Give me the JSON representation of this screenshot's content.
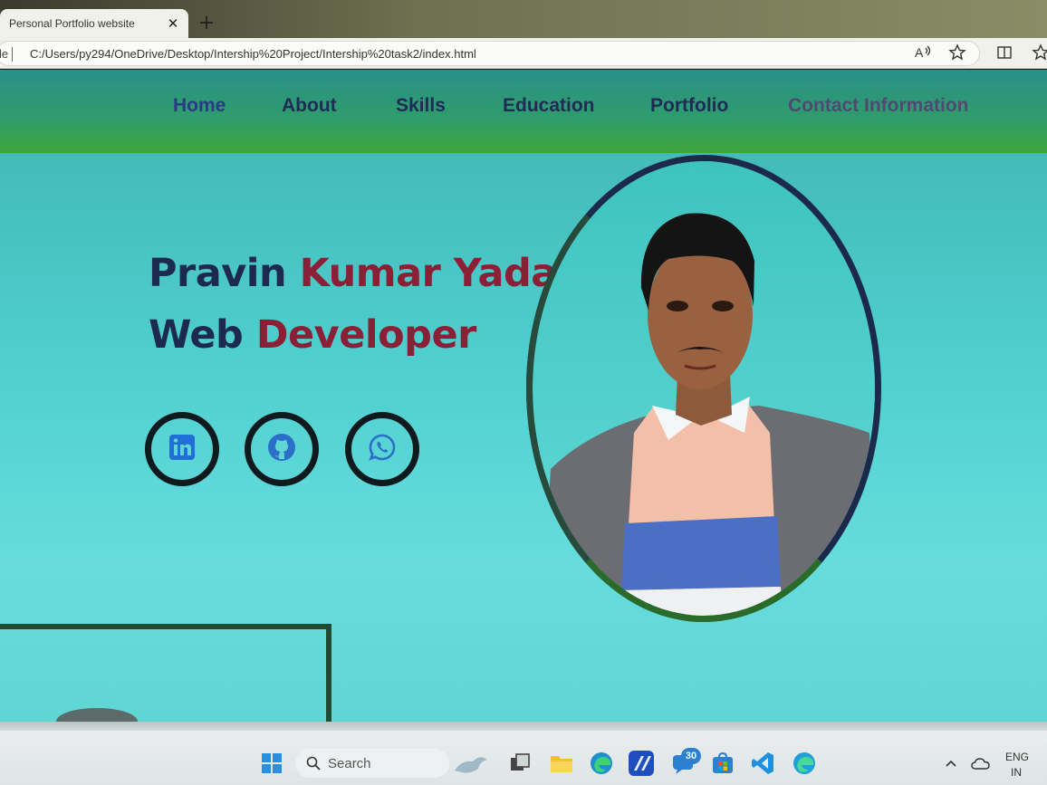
{
  "browser": {
    "tab_title": "Personal Portfolio website",
    "tab_close_glyph": "✕",
    "new_tab_glyph": "+",
    "site_info_label": "le",
    "url": "C:/Users/py294/OneDrive/Desktop/Intership%20Project/Intership%20task2/index.html",
    "toolbar_icons": [
      "read-aloud-icon",
      "favorite-star-icon",
      "split-screen-icon",
      "favorites-icon"
    ]
  },
  "nav": {
    "items": [
      "Home",
      "About",
      "Skills",
      "Education",
      "Portfolio",
      "Contact Information"
    ]
  },
  "hero": {
    "first_name": "Pravin",
    "last_name": "Kumar Yadav",
    "role_prefix": "Web",
    "role_accent": "Developer"
  },
  "social": [
    "linkedin-icon",
    "github-icon",
    "whatsapp-icon"
  ],
  "colors": {
    "heading_dark": "#1c2a4f",
    "heading_accent": "#8a1f35",
    "page_bg": "#4fcfcf",
    "navbar_green": "#3ea53a"
  },
  "taskbar": {
    "search_placeholder": "Search",
    "notification_badge": "30",
    "language": "ENG",
    "region": "IN"
  }
}
